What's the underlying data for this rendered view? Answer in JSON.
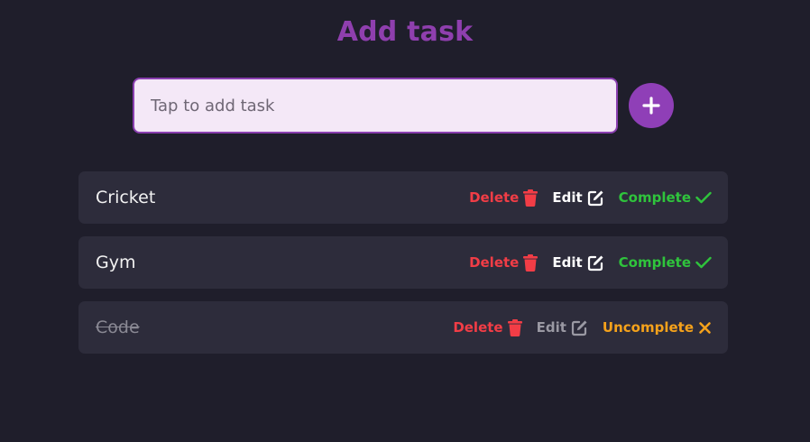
{
  "header": {
    "title": "Add task"
  },
  "input": {
    "placeholder": "Tap to add task",
    "value": ""
  },
  "add_button": {
    "icon": "plus-icon"
  },
  "colors": {
    "background": "#1f1e2b",
    "title": "#8f3fae",
    "card": "#2d2c3b",
    "delete": "#f23d46",
    "complete": "#2fc43c",
    "uncomplete": "#f5a21b"
  },
  "tasks": [
    {
      "name": "Cricket",
      "done": false,
      "delete_label": "Delete",
      "edit_label": "Edit",
      "status_label": "Complete",
      "status_icon": "check-icon"
    },
    {
      "name": "Gym",
      "done": false,
      "delete_label": "Delete",
      "edit_label": "Edit",
      "status_label": "Complete",
      "status_icon": "check-icon"
    },
    {
      "name": "Code",
      "done": true,
      "delete_label": "Delete",
      "edit_label": "Edit",
      "status_label": "Uncomplete",
      "status_icon": "x-icon"
    }
  ]
}
